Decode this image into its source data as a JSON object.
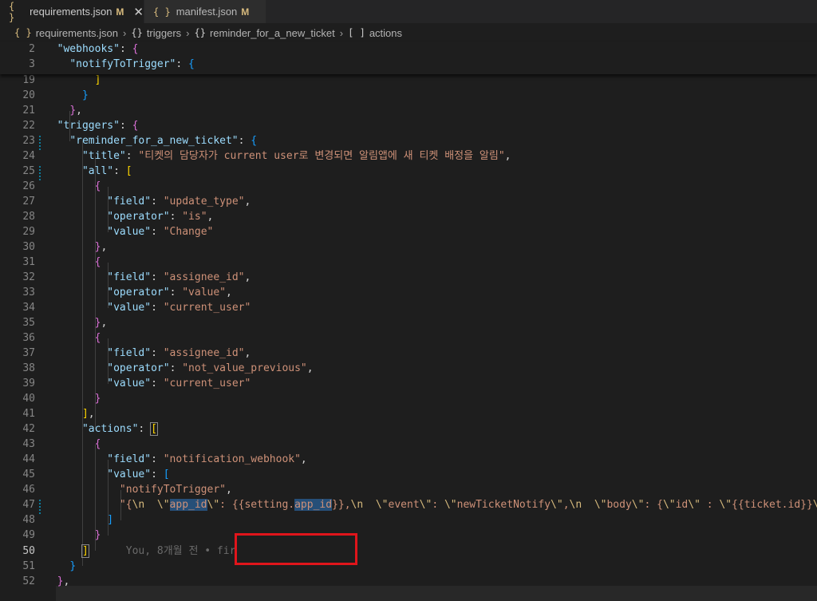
{
  "tabs": [
    {
      "icon": "{ }",
      "label": "requirements.json",
      "status": "M",
      "close": "✕"
    },
    {
      "icon": "{ }",
      "label": "manifest.json",
      "status": "M"
    }
  ],
  "breadcrumb": [
    {
      "icon": "{ }",
      "label": "requirements.json"
    },
    {
      "icon": "{}",
      "label": "triggers"
    },
    {
      "icon": "{}",
      "label": "reminder_for_a_new_ticket"
    },
    {
      "icon": "[ ]",
      "label": "actions"
    }
  ],
  "sticky_lines": [
    {
      "n": "2",
      "code": "  \"webhooks\": {"
    },
    {
      "n": "3",
      "code": "    \"notifyToTrigger\": {"
    }
  ],
  "lines": [
    {
      "n": "19",
      "code": "        ]"
    },
    {
      "n": "20",
      "code": "      }"
    },
    {
      "n": "21",
      "code": "    },"
    },
    {
      "n": "22",
      "code": "  \"triggers\": {"
    },
    {
      "n": "23",
      "code": "    \"reminder_for_a_new_ticket\": {"
    },
    {
      "n": "24",
      "code": "      \"title\": \"티켓의 담당자가 current user로 변경되면 알림앱에 새 티켓 배정을 알림\","
    },
    {
      "n": "25",
      "code": "      \"all\": ["
    },
    {
      "n": "26",
      "code": "        {"
    },
    {
      "n": "27",
      "code": "          \"field\": \"update_type\","
    },
    {
      "n": "28",
      "code": "          \"operator\": \"is\","
    },
    {
      "n": "29",
      "code": "          \"value\": \"Change\""
    },
    {
      "n": "30",
      "code": "        },"
    },
    {
      "n": "31",
      "code": "        {"
    },
    {
      "n": "32",
      "code": "          \"field\": \"assignee_id\","
    },
    {
      "n": "33",
      "code": "          \"operator\": \"value\","
    },
    {
      "n": "34",
      "code": "          \"value\": \"current_user\""
    },
    {
      "n": "35",
      "code": "        },"
    },
    {
      "n": "36",
      "code": "        {"
    },
    {
      "n": "37",
      "code": "          \"field\": \"assignee_id\","
    },
    {
      "n": "38",
      "code": "          \"operator\": \"not_value_previous\","
    },
    {
      "n": "39",
      "code": "          \"value\": \"current_user\""
    },
    {
      "n": "40",
      "code": "        }"
    },
    {
      "n": "41",
      "code": "      ],"
    },
    {
      "n": "42",
      "code": "      \"actions\": ["
    },
    {
      "n": "43",
      "code": "        {"
    },
    {
      "n": "44",
      "code": "          \"field\": \"notification_webhook\","
    },
    {
      "n": "45",
      "code": "          \"value\": ["
    },
    {
      "n": "46",
      "code": "            \"notifyToTrigger\","
    },
    {
      "n": "47",
      "code": "            \"{\\n  \\\"app_id\\\": {{setting.app_id}},\\n  \\\"event\\\": \\\"newTicketNotify\\\",\\n  \\\"body\\\": {\\\"id\\\" : \\\"{{ticket.id}}\\"
    },
    {
      "n": "48",
      "code": "          ]"
    },
    {
      "n": "49",
      "code": "        }"
    },
    {
      "n": "50",
      "code": "      ]",
      "blame": "You, 8개월 전 • fir"
    },
    {
      "n": "51",
      "code": "    }"
    },
    {
      "n": "52",
      "code": "  },"
    }
  ]
}
